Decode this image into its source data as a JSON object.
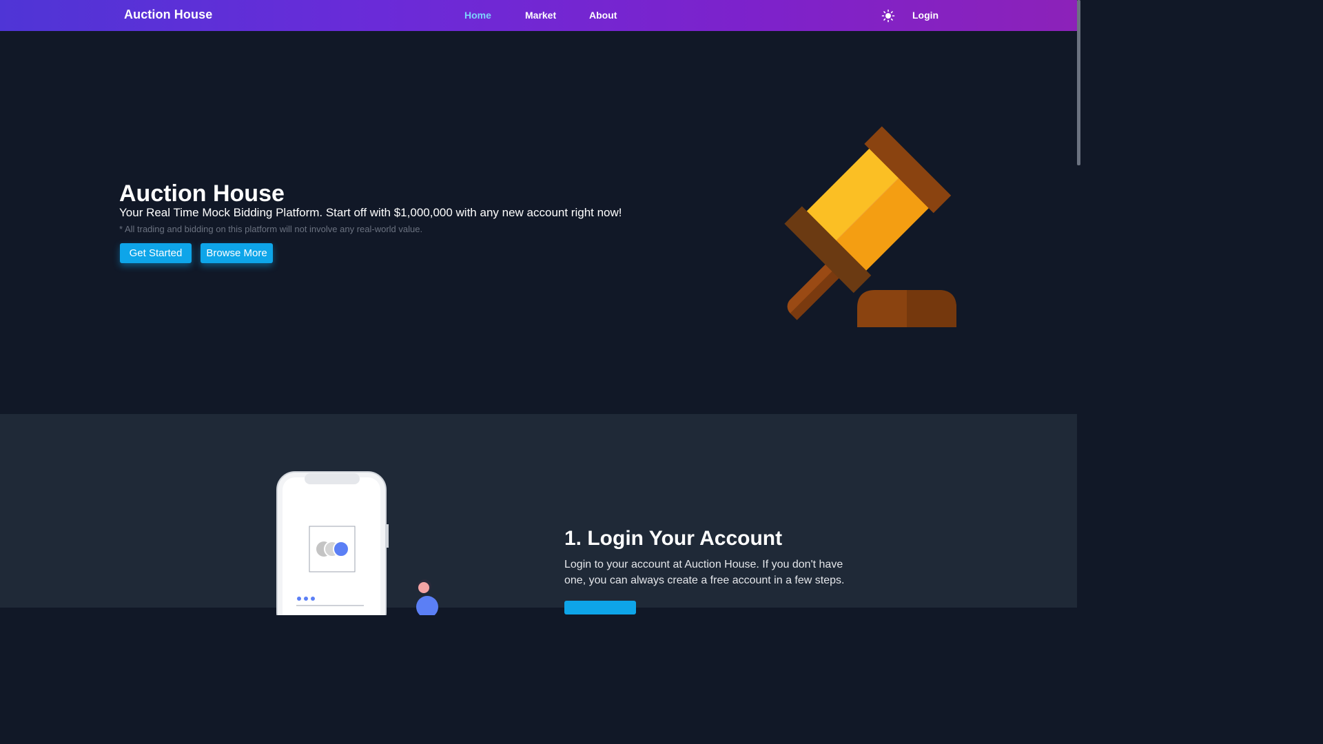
{
  "nav": {
    "brand": "Auction House",
    "links": [
      "Home",
      "Market",
      "About"
    ],
    "active": "Home",
    "login": "Login",
    "theme_icon": "sun-icon"
  },
  "hero": {
    "title": "Auction House",
    "subtitle": "Your Real Time Mock Bidding Platform. Start off with $1,000,000 with any new account right now!",
    "note": "* All trading and bidding on this platform will not involve any real-world value.",
    "buttons": {
      "get_started": "Get Started",
      "browse_more": "Browse More"
    },
    "illustration": "gavel-icon"
  },
  "steps": {
    "title": "1. Login Your Account",
    "description": "Login to your account at Auction House. If you don't have one, you can always create a free account in a few steps.",
    "illustration": "phone-login-icon"
  },
  "colors": {
    "nav_gradient_start": "#4f35d6",
    "nav_gradient_end": "#8c22b9",
    "hero_bg": "#111827",
    "section_bg": "#1f2937",
    "accent": "#0ea5e9",
    "active_link": "#7dd3fc"
  }
}
